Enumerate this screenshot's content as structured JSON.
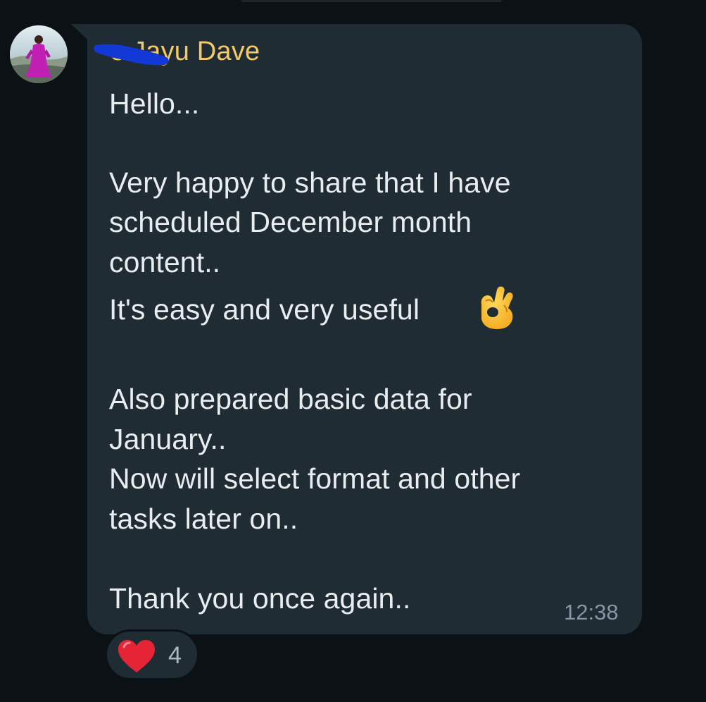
{
  "message": {
    "sender_visible": "s Jayu Dave",
    "lines": [
      "Hello...",
      "Very happy to share that I have",
      "scheduled December month",
      "content..",
      "It's easy and very useful",
      "Also prepared basic data for",
      "January..",
      "Now will select format and other",
      "tasks later on..",
      "Thank you once again.."
    ],
    "emoji": "ok-hand-emoji",
    "time": "12:38"
  },
  "reaction": {
    "icon": "red-heart-icon",
    "count": "4"
  },
  "colors": {
    "background": "#0b1114",
    "bubble": "#1f2c33",
    "sender": "#f6c968",
    "text": "#e9edef",
    "meta": "#8696a0",
    "redaction": "#1238d6"
  }
}
